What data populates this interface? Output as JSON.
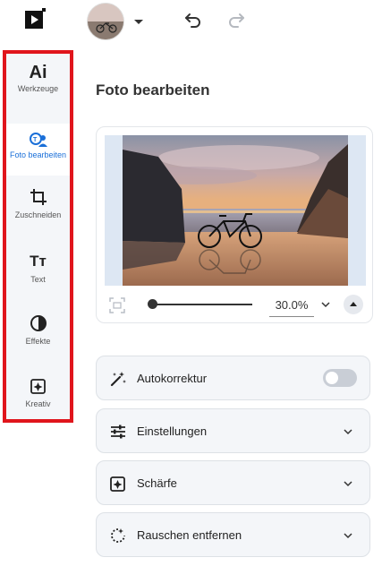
{
  "topbar": {
    "logo_icon": "play-logo-icon",
    "avatar_icon": "user-avatar",
    "undo_icon": "undo-icon",
    "redo_icon": "redo-icon"
  },
  "sidebar": {
    "items": [
      {
        "label": "Werkzeuge",
        "icon": "ai-icon",
        "glyph": "Ai",
        "active": false
      },
      {
        "label": "Foto bearbeiten",
        "icon": "photo-edit-icon",
        "active": true
      },
      {
        "label": "Zuschneiden",
        "icon": "crop-icon",
        "active": false
      },
      {
        "label": "Text",
        "icon": "text-icon",
        "glyph": "Tт",
        "active": false
      },
      {
        "label": "Effekte",
        "icon": "contrast-icon",
        "active": false
      },
      {
        "label": "Kreativ",
        "icon": "sparkle-icon",
        "active": false
      }
    ]
  },
  "main": {
    "title": "Foto bearbeiten",
    "zoom": {
      "value": "30.0%",
      "slider_fraction": 0.0
    },
    "panels": [
      {
        "label": "Autokorrektur",
        "icon": "magic-wand-icon",
        "control": "toggle",
        "toggle_on": false
      },
      {
        "label": "Einstellungen",
        "icon": "sliders-icon",
        "control": "chevron"
      },
      {
        "label": "Schärfe",
        "icon": "sharpen-icon",
        "control": "chevron"
      },
      {
        "label": "Rauschen entfernen",
        "icon": "denoise-icon",
        "control": "chevron"
      }
    ]
  },
  "colors": {
    "accent": "#1a6fd8",
    "highlight_border": "#e0151c",
    "panel_bg": "#f4f6f9"
  }
}
